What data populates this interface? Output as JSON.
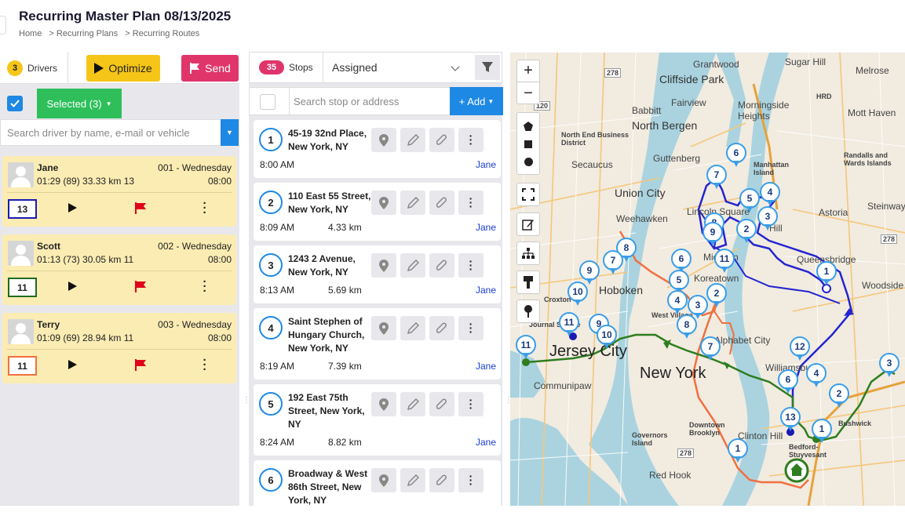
{
  "header": {
    "title": "Recurring Master Plan 08/13/2025",
    "breadcrumb": [
      "Home",
      "> Recurring Plans",
      "> Recurring Routes"
    ]
  },
  "drivers_panel": {
    "count": "3",
    "label": "Drivers",
    "optimize_label": "Optimize",
    "send_label": "Send",
    "selected_label": "Selected (3)",
    "search_placeholder": "Search driver by name, e-mail or vehicle",
    "drivers": [
      {
        "name": "Jane",
        "stats": "01:29 (89) 33.33 km 13",
        "route": "001 - Wednesday",
        "time": "08:00",
        "badge": "13",
        "color": "#1a1ab0"
      },
      {
        "name": "Scott",
        "stats": "01:13 (73) 30.05 km 11",
        "route": "002 - Wednesday",
        "time": "08:00",
        "badge": "11",
        "color": "#1e6b1e"
      },
      {
        "name": "Terry",
        "stats": "01:09 (69) 28.94 km 11",
        "route": "003 - Wednesday",
        "time": "08:00",
        "badge": "11",
        "color": "#f07040"
      }
    ]
  },
  "stops_panel": {
    "count": "35",
    "label": "Stops",
    "filter_value": "Assigned",
    "search_placeholder": "Search stop or address",
    "add_label": "+ Add",
    "stops": [
      {
        "num": "1",
        "address": "45-19 32nd Place, New York, NY",
        "time": "8:00 AM",
        "distance": "",
        "driver": "Jane"
      },
      {
        "num": "2",
        "address": "110 East 55 Street, New York, NY",
        "time": "8:09 AM",
        "distance": "4.33 km",
        "driver": "Jane"
      },
      {
        "num": "3",
        "address": "1243 2 Avenue, New York, NY",
        "time": "8:13 AM",
        "distance": "5.69 km",
        "driver": "Jane"
      },
      {
        "num": "4",
        "address": "Saint Stephen of Hungary Church, New York, NY",
        "time": "8:19 AM",
        "distance": "7.39 km",
        "driver": "Jane"
      },
      {
        "num": "5",
        "address": "192 East 75th Street, New York, NY",
        "time": "8:24 AM",
        "distance": "8.82 km",
        "driver": "Jane"
      },
      {
        "num": "6",
        "address": "Broadway & West 86th Street, New York, NY",
        "time": "",
        "distance": "",
        "driver": ""
      }
    ]
  },
  "map": {
    "labels": {
      "grantwood": "Grantwood",
      "sugar_hill": "Sugar Hill",
      "melrose": "Melrose",
      "cliffside_park": "Cliffside Park",
      "babbitt": "Babbitt",
      "fairview": "Fairview",
      "morningside": "Morningside Heights",
      "hrd": "HRD",
      "mott_haven": "Mott Haven",
      "north_end": "North End Business District",
      "north_bergen": "North Bergen",
      "guttenberg": "Guttenberg",
      "secaucus": "Secaucus",
      "manhattan_island": "Manhattan Island",
      "randalls": "Randalls and Wards Islands",
      "union_city": "Union City",
      "steinway": "Steinway",
      "weehawken": "Weehawken",
      "astoria": "Astoria",
      "lincoln_square": "Lincoln Square",
      "queensbridge": "Queensbridge",
      "midtown": "Midtown",
      "koreatown": "Koreatown",
      "hoboken": "Hoboken",
      "woodside": "Woodside",
      "croxton": "Croxton",
      "journal_square": "Journal Square",
      "west_village": "West Village",
      "jersey_city": "Jersey City",
      "new_york": "New York",
      "alphabet_city": "Alphabet City",
      "williamsburg": "Williamsburg",
      "communipaw": "Communipaw",
      "downtown_brooklyn": "Downtown Brooklyn",
      "governors": "Governors Island",
      "clinton_hill": "Clinton Hill",
      "bushwick": "Bushwick",
      "bedford": "Bedford-Stuyvesant",
      "red_hook": "Red Hook",
      "hill": "Hill",
      "sh120": "120",
      "sh278a": "278",
      "sh278b": "278",
      "sh278c": "278"
    }
  }
}
